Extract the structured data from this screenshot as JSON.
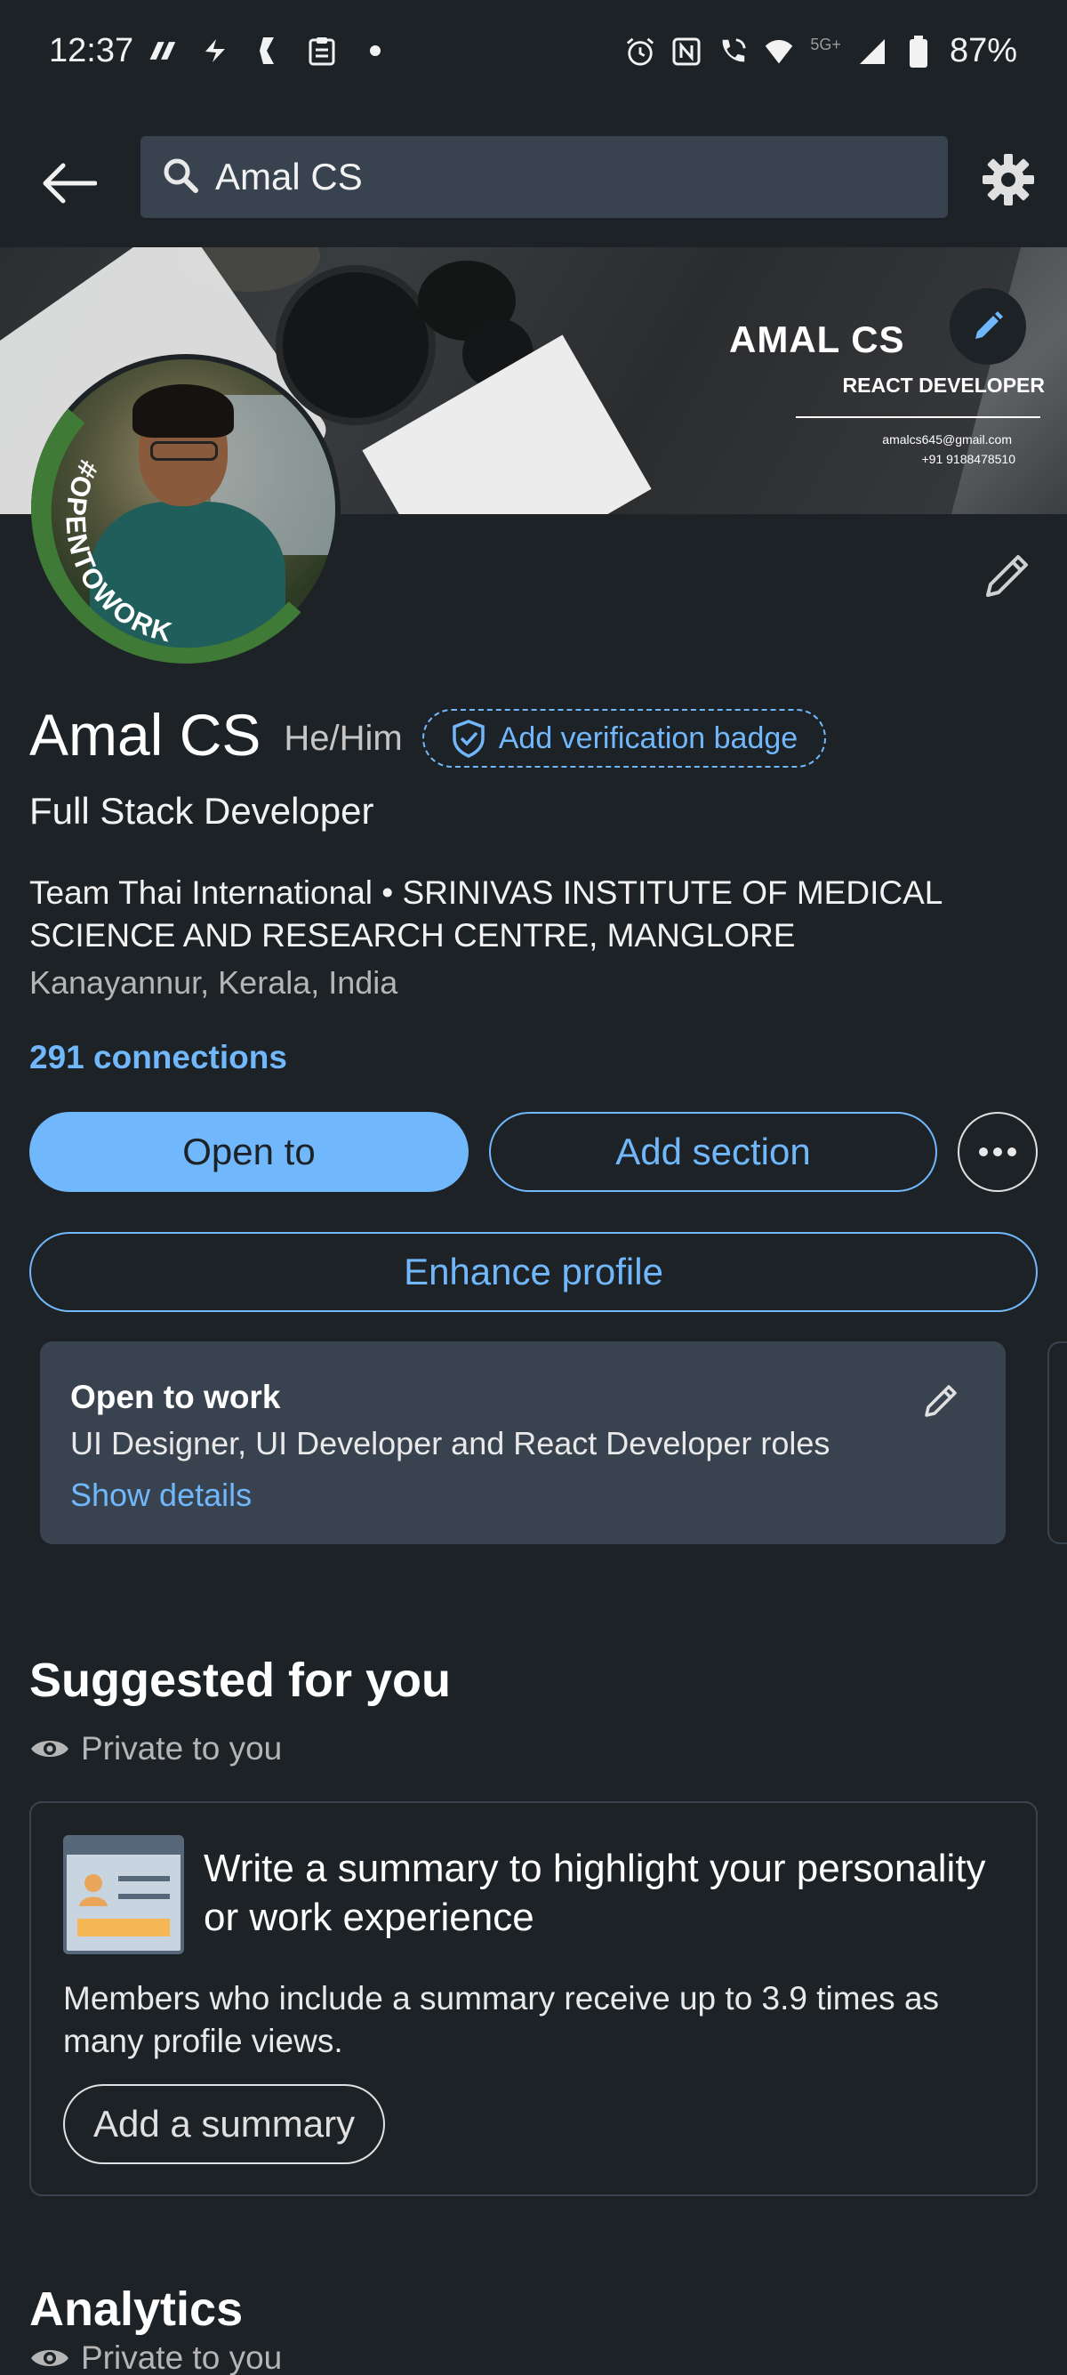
{
  "status_bar": {
    "time": "12:37",
    "network": "5G+",
    "battery": "87%"
  },
  "nav": {
    "search_value": "Amal CS"
  },
  "banner": {
    "name": "AMAL CS",
    "role": "REACT DEVELOPER",
    "email": "amalcs645@gmail.com",
    "phone": "+91 9188478510"
  },
  "profile": {
    "open_to_work_ring": "#OPENTOWORK",
    "name": "Amal CS",
    "pronouns": "He/Him",
    "verification_badge": "Add verification badge",
    "headline": "Full Stack  Developer",
    "company": "Team Thai International • SRINIVAS INSTITUTE OF MEDICAL SCIENCE AND RESEARCH CENTRE, MANGLORE",
    "location": "Kanayannur, Kerala, India",
    "connections": "291 connections"
  },
  "actions": {
    "open_to": "Open to",
    "add_section": "Add section",
    "enhance_profile": "Enhance profile"
  },
  "open_to_work": {
    "title": "Open to work",
    "roles": "UI Designer, UI Developer and React Developer roles",
    "details_link": "Show details"
  },
  "suggested": {
    "title": "Suggested for you",
    "privacy": "Private to you",
    "card_title": "Write a summary to highlight your personality or work experience",
    "card_desc": "Members who include a summary receive up to 3.9 times as many profile views.",
    "card_button": "Add a summary"
  },
  "analytics": {
    "title": "Analytics",
    "privacy": "Private to you"
  },
  "colors": {
    "background": "#1d2226",
    "card": "#38434f",
    "accent": "#71b7fb"
  }
}
